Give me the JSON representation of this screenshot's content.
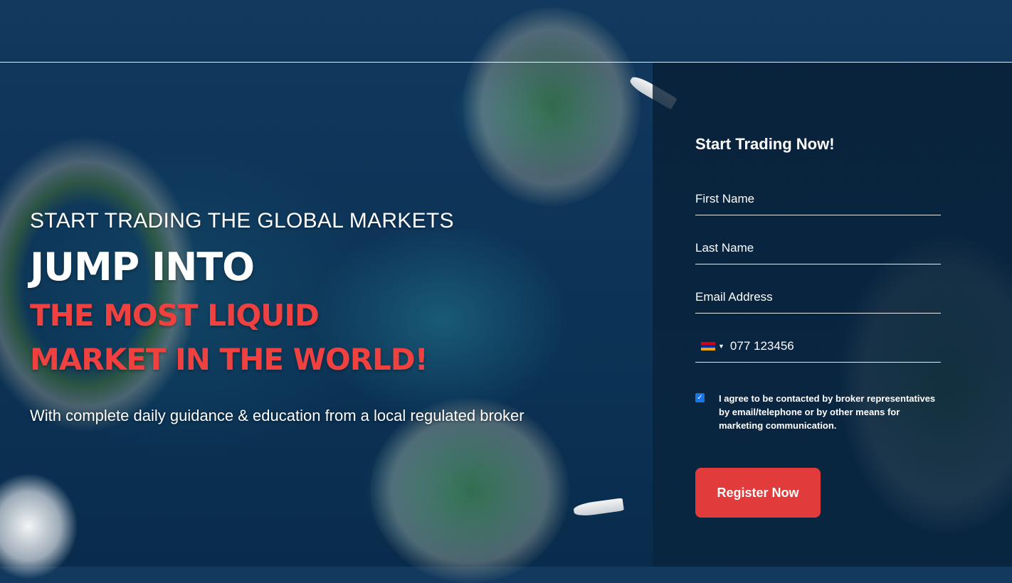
{
  "hero": {
    "subtitle": "START TRADING THE GLOBAL MARKETS",
    "title": "JUMP INTO",
    "highlight_line1": "THE MOST LIQUID",
    "highlight_line2": "MARKET IN THE WORLD!",
    "description": "With complete daily guidance & education from a local regulated broker"
  },
  "form": {
    "title": "Start Trading Now!",
    "first_name_placeholder": "First Name",
    "last_name_placeholder": "Last Name",
    "email_placeholder": "Email Address",
    "phone_placeholder": "077 123456",
    "country_flag": "armenia-flag-icon",
    "consent_checked": true,
    "consent_text": "I agree to be contacted by broker representatives by email/telephone or by other means for marketing communication.",
    "submit_label": "Register Now"
  },
  "colors": {
    "accent": "#e23b3b",
    "highlight_text": "#f04141",
    "checkbox": "#1a73e8"
  }
}
